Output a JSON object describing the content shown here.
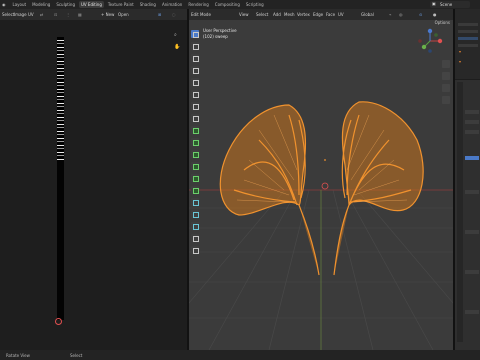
{
  "topbar": {
    "tabs": [
      "Layout",
      "Modeling",
      "Sculpting",
      "UV Editing",
      "Texture Paint",
      "Shading",
      "Animation",
      "Rendering",
      "Compositing",
      "Scripting"
    ],
    "active_tab": "UV Editing",
    "scene_name": "Scene"
  },
  "uv_header": {
    "select": "Select",
    "image": "Image",
    "uv": "UV",
    "new": "+ New",
    "open": "Open"
  },
  "viewport_header": {
    "mode": "Edit Mode",
    "view": "View",
    "select": "Select",
    "add": "Add",
    "mesh": "Mesh",
    "vertex": "Vertex",
    "edge": "Edge",
    "face": "Face",
    "uv": "UV",
    "transform": "Global",
    "options": "Options"
  },
  "viewport": {
    "view_name": "User Perspective",
    "object_name": "(102) sweep"
  },
  "statusbar": {
    "left": "Rotate View",
    "middle": "Select"
  },
  "colors": {
    "mesh": "#f0922e",
    "active": "#4a79c7",
    "grid": "#4c4c4c"
  }
}
